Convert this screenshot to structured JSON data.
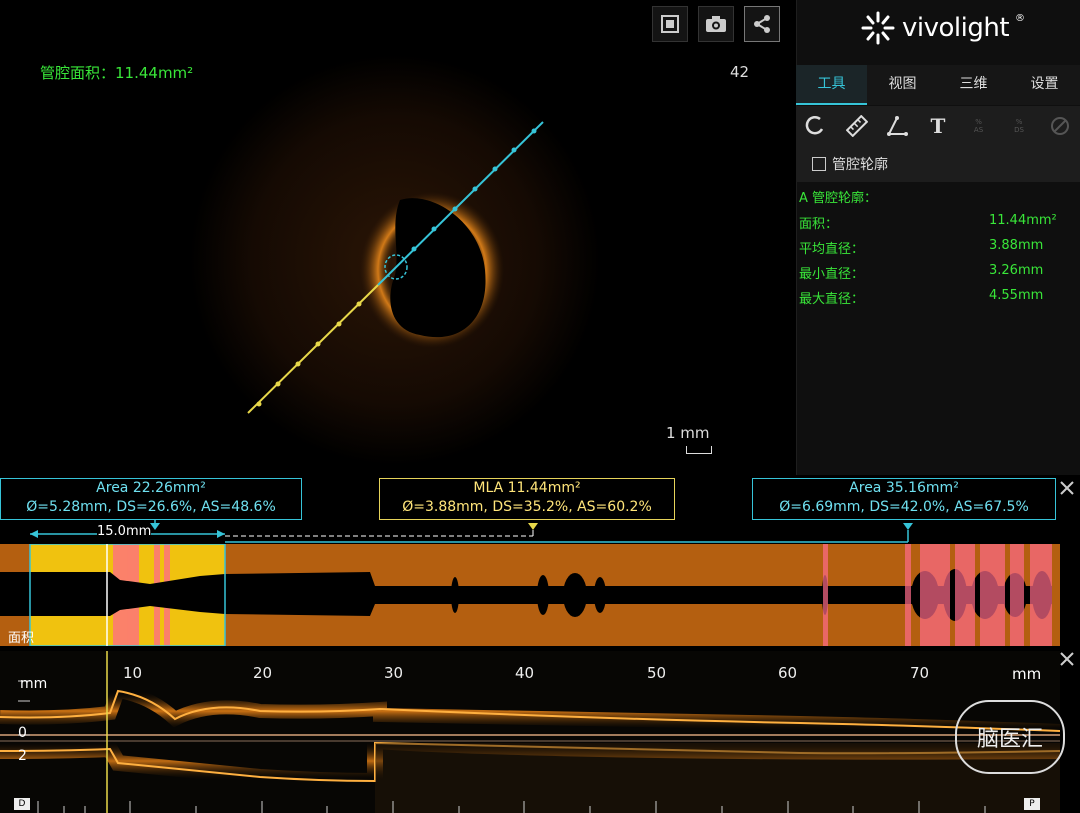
{
  "view": {
    "area_readout": "管腔面积：11.44mm²",
    "frame_number": "42",
    "scale": "1 mm"
  },
  "panel": {
    "logo_text": "vivolight",
    "logo_reg": "®",
    "tabs": [
      {
        "label": "工具",
        "active": true
      },
      {
        "label": "视图",
        "active": false
      },
      {
        "label": "三维",
        "active": false
      },
      {
        "label": "设置",
        "active": false
      }
    ],
    "tools": [
      {
        "icon": "lasso-icon"
      },
      {
        "icon": "ruler-icon"
      },
      {
        "icon": "angle-icon"
      },
      {
        "icon": "text-icon",
        "glyph": "T"
      },
      {
        "icon": "area-stenosis-icon",
        "sub": [
          "%",
          "AS"
        ]
      },
      {
        "icon": "diameter-stenosis-icon",
        "sub": [
          "%",
          "DS"
        ]
      },
      {
        "icon": "disabled-tool-icon"
      }
    ],
    "contour_checkbox_label": "管腔轮廓",
    "measurement_title": "A 管腔轮廓：",
    "measurements": [
      {
        "label": "面积：",
        "value": "11.44mm²"
      },
      {
        "label": "平均直径：",
        "value": "3.88mm"
      },
      {
        "label": "最小直径：",
        "value": "3.26mm"
      },
      {
        "label": "最大直径：",
        "value": "4.55mm"
      }
    ]
  },
  "boxes": {
    "proximal_line1": "Area 22.26mm²",
    "proximal_line2": "Ø=5.28mm, DS=26.6%, AS=48.6%",
    "mla_line1": "MLA 11.44mm²",
    "mla_line2": "Ø=3.88mm, DS=35.2%, AS=60.2%",
    "distal_line1": "Area 35.16mm²",
    "distal_line2": "Ø=6.69mm, DS=42.0%, AS=67.5%",
    "length": "15.0mm"
  },
  "longitudinal": {
    "area_label": "面积",
    "unit": "mm",
    "ticks": [
      "10",
      "20",
      "30",
      "40",
      "50",
      "60",
      "70"
    ],
    "depth_0": "0",
    "depth_2": "2",
    "marker_left": "D",
    "marker_right": "P"
  },
  "watermark": "脑医汇",
  "colors": {
    "accent": "#36c4d8",
    "measure_green": "#39e639",
    "mla_yellow": "#ffe57a",
    "vessel_orange": "#b45f10"
  }
}
